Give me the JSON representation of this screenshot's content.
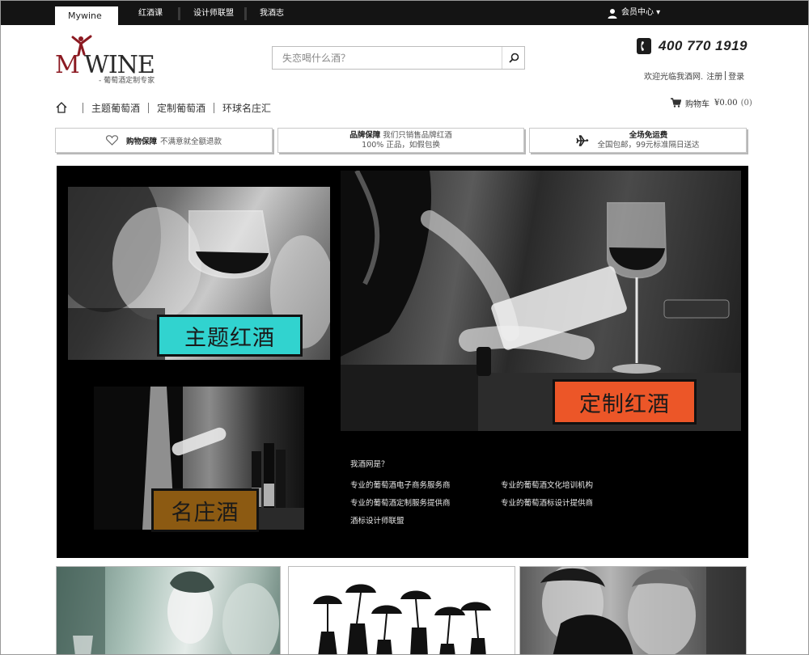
{
  "topbar": {
    "active_tab": "Mywine",
    "links": [
      "红酒课",
      "设计师联盟",
      "我酒志"
    ],
    "member_center": "会员中心 ▾"
  },
  "header": {
    "logo_m": "M",
    "logo_rest": "WINE",
    "logo_tagline": "- 葡萄酒定制专家",
    "search_placeholder": "失恋喝什么酒？",
    "phone": "400 770 1919",
    "welcome": "欢迎光临我酒网.",
    "register": "注册",
    "login": "登录"
  },
  "nav": {
    "items": [
      "主题葡萄酒",
      "定制葡萄酒",
      "环球名庄汇"
    ],
    "cart_label": "购物车",
    "cart_price": "¥0.00",
    "cart_count": "(0)"
  },
  "guarantees": [
    {
      "title": "购物保障",
      "text": "不满意就全额退款"
    },
    {
      "title": "品牌保障",
      "text": "我们只销售品牌红酒",
      "line2": "100% 正品，如假包换"
    },
    {
      "title": "全场免运费",
      "line2": "全国包邮，99元标准隔日送达"
    }
  ],
  "banner": {
    "labels": {
      "theme": "主题红酒",
      "custom": "定制红酒",
      "chateau": "名庄酒"
    },
    "about_title": "我酒网是？",
    "about_items": [
      "专业的葡萄酒电子商务服务商",
      "专业的葡萄酒文化培训机构",
      "专业的葡萄酒定制服务提供商",
      "专业的葡萄酒标设计提供商",
      "酒标设计师联盟"
    ]
  },
  "icons": [
    "user-icon",
    "search-icon",
    "phone-icon",
    "home-icon",
    "cart-icon",
    "heart-icon",
    "plane-icon"
  ],
  "colors": {
    "topbar": "#141414",
    "theme_label": "#31d3cf",
    "custom_label": "#ec5628",
    "chateau_label": "#8c5a12",
    "logo_red": "#8c1a22"
  }
}
